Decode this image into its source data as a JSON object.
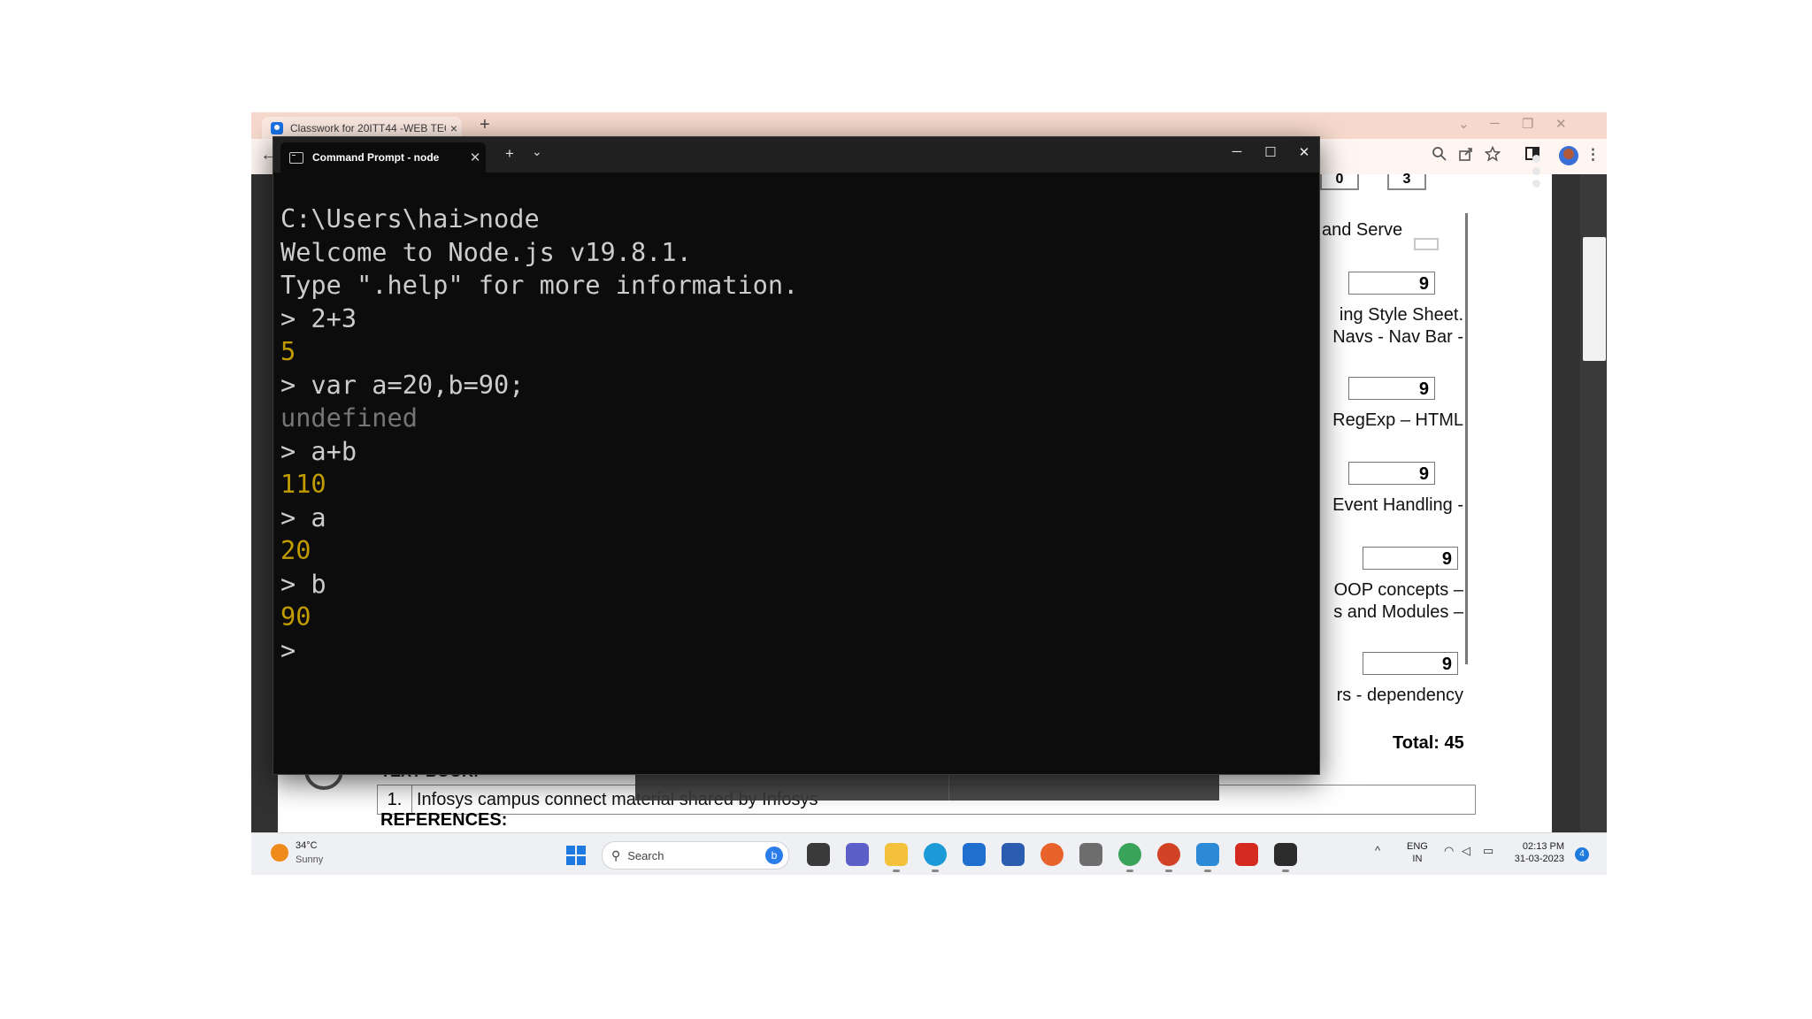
{
  "chrome": {
    "tab_title": "Classwork for 20ITT44 -WEB TEC",
    "tab_close": "×",
    "new_tab": "+",
    "window_controls": [
      "⌄",
      "─",
      "❐",
      "✕"
    ],
    "back": "←",
    "toolbar_icons": [
      "zoom-icon",
      "share-icon",
      "star-icon",
      "sidepanel-icon",
      "profile-avatar",
      "menu-icon"
    ]
  },
  "pdf": {
    "header_cells": [
      "0",
      "3"
    ],
    "rows": [
      {
        "text": [
          "and Serve"
        ],
        "hours": ""
      },
      {
        "text": [],
        "hours": "9"
      },
      {
        "text": [
          "ing Style Sheet.",
          "Navs - Nav Bar -"
        ],
        "hours": ""
      },
      {
        "text": [],
        "hours": "9"
      },
      {
        "text": [
          "RegExp – HTML"
        ],
        "hours": ""
      },
      {
        "text": [],
        "hours": "9"
      },
      {
        "text": [
          "Event Handling -"
        ],
        "hours": ""
      },
      {
        "text": [],
        "hours": "9"
      },
      {
        "text": [
          "OOP  concepts  –",
          "s and Modules –"
        ],
        "hours": ""
      },
      {
        "text": [],
        "hours": "9"
      },
      {
        "text": [
          "rs - dependency"
        ],
        "hours": ""
      }
    ],
    "total": "Total: 45",
    "textbook_heading": "TEXT BOOK:",
    "textbook_number": "1.",
    "textbook_entry": "Infosys campus connect material shared by Infosys",
    "references_heading": "REFERENCES:"
  },
  "terminal": {
    "tab_title": "Command Prompt - node",
    "tab_close": "✕",
    "new_tab": "+",
    "dropdown": "⌄",
    "window_controls": [
      "─",
      "☐",
      "✕"
    ],
    "lines": [
      {
        "text": "C:\\Users\\hai>node",
        "kind": "cmd"
      },
      {
        "text": "Welcome to Node.js v19.8.1.",
        "kind": "out"
      },
      {
        "text": "Type \".help\" for more information.",
        "kind": "out"
      },
      {
        "text": "> 2+3",
        "kind": "cmd"
      },
      {
        "text": "5",
        "kind": "num"
      },
      {
        "text": "> var a=20,b=90;",
        "kind": "cmd"
      },
      {
        "text": "undefined",
        "kind": "undef"
      },
      {
        "text": "> a+b",
        "kind": "cmd"
      },
      {
        "text": "110",
        "kind": "num"
      },
      {
        "text": "> a",
        "kind": "cmd"
      },
      {
        "text": "20",
        "kind": "num"
      },
      {
        "text": "> b",
        "kind": "cmd"
      },
      {
        "text": "90",
        "kind": "num"
      },
      {
        "text": ">",
        "kind": "cmd"
      }
    ],
    "colors": {
      "background": "#0c0c0c",
      "text": "#cccccc",
      "number": "#c19c00",
      "undefined": "#767676"
    }
  },
  "taskbar": {
    "weather_temp": "34°C",
    "weather_condition": "Sunny",
    "search_placeholder": "Search",
    "apps": [
      "file-explorer-icon",
      "teams-chat-icon",
      "folder-icon",
      "edge-icon",
      "mail-icon",
      "store-icon",
      "firefox-icon",
      "scanner-icon",
      "chrome-icon",
      "powerpoint-icon",
      "notepad-icon",
      "acrobat-icon",
      "terminal-icon"
    ],
    "tray_chevron": "^",
    "lang_line1": "ENG",
    "lang_line2": "IN",
    "time": "02:13 PM",
    "date": "31-03-2023",
    "notification_count": "4"
  }
}
